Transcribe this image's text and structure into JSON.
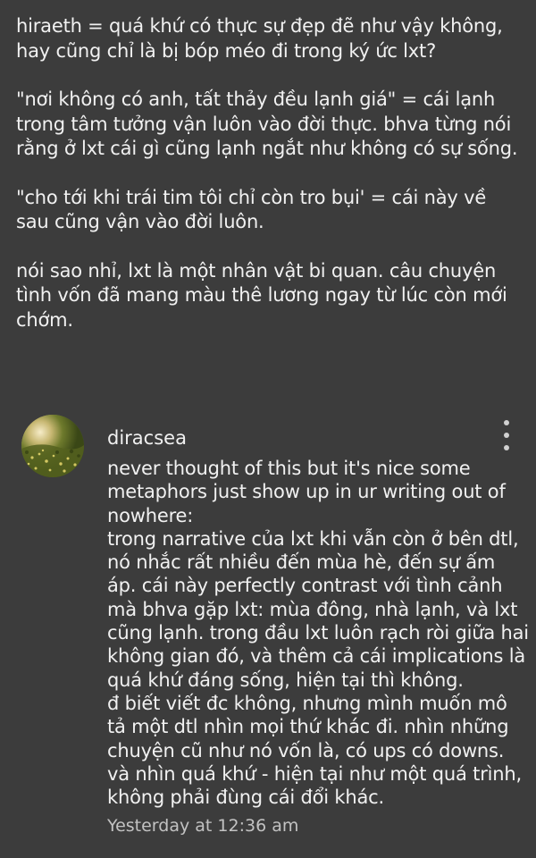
{
  "post": {
    "paragraphs": [
      "hiraeth = quá khứ có thực sự đẹp đẽ như vậy không, hay cũng chỉ là bị bóp méo đi trong ký ức lxt?",
      "\"nơi không có anh, tất thảy đều lạnh giá\" = cái lạnh trong tâm tưởng vận luôn vào đời thực. bhva từng nói rằng ở lxt cái gì cũng lạnh ngắt như không có sự sống.",
      "\"cho tới khi trái tim tôi chỉ còn tro bụi' = cái này về sau cũng vận vào đời luôn.",
      "nói sao nhỉ, lxt là một nhân vật bi quan. câu chuyện tình vốn đã mang màu thê lương ngay từ lúc còn mới chớm."
    ]
  },
  "comment": {
    "author": "diracsea",
    "avatar_icon": "sunlit-field-avatar",
    "more_icon": "more-vertical-icon",
    "lines": [
      "never thought of this but it's nice some",
      "metaphors just show up in ur writing out of",
      "nowhere:",
      "trong narrative của lxt khi vẫn còn ở bên dtl,",
      "nó nhắc rất nhiều đến mùa hè, đến sự ấm",
      "áp. cái này perfectly contrast với tình cảnh",
      "mà bhva gặp lxt: mùa đông, nhà lạnh, và lxt",
      "cũng lạnh. trong đầu lxt luôn rạch ròi giữa hai",
      "không gian đó, và thêm cả cái implications là",
      "quá khứ đáng sống, hiện tại thì không.",
      "đ biết viết đc không, nhưng mình muốn mô",
      "tả một dtl nhìn mọi thứ khác đi. nhìn những",
      "chuyện cũ như nó vốn là, có ups có downs.",
      "và nhìn quá khứ - hiện tại như một quá trình,",
      "không phải đùng cái đổi khác."
    ],
    "timestamp": "Yesterday at 12:36 am"
  }
}
